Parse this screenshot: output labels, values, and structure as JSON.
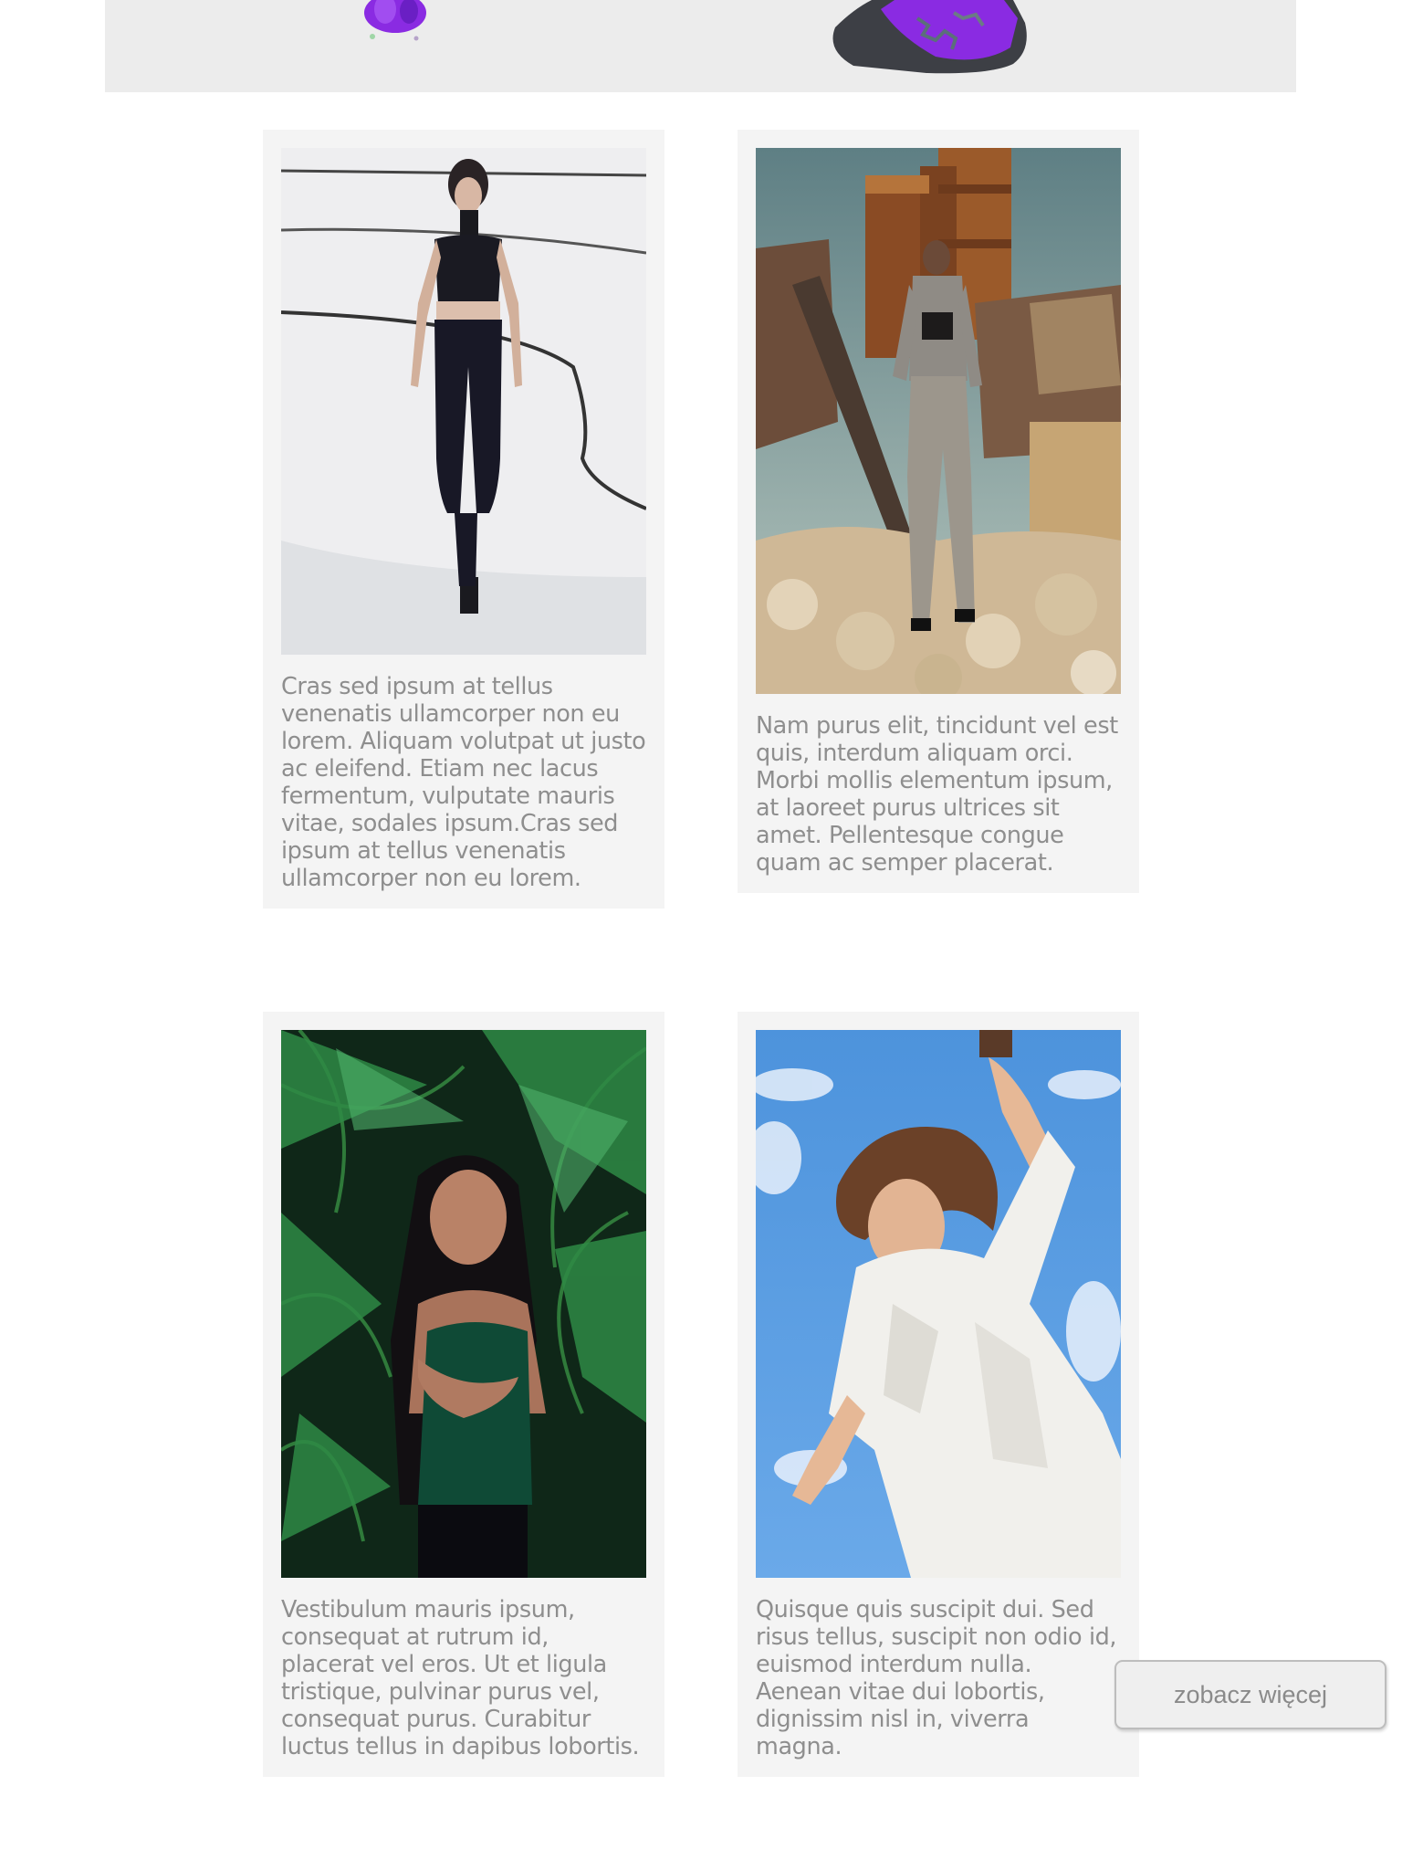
{
  "banner": {
    "accent": "#8a2be2"
  },
  "cards": [
    {
      "image": "runway-model-black-outfit",
      "text": "Cras sed ipsum at tellus venenatis ullamcorper non eu lorem. Aliquam volutpat ut justo ac eleifend. Etiam nec lacus fermentum, vulputate mauris vitae, sodales ipsum.Cras sed ipsum at tellus venenatis ullamcorper non eu lorem."
    },
    {
      "image": "model-grey-suit-industrial-ruins",
      "text": "Nam purus elit, tincidunt vel est quis, interdum aliquam orci. Morbi mollis elementum ipsum, at laoreet purus ultrices sit amet. Pellentesque congue quam ac semper placerat."
    },
    {
      "image": "model-green-top-palm-leaves",
      "text": "Vestibulum mauris ipsum, consequat at rutrum id, placerat vel eros. Ut et ligula tristique, pulvinar purus vel, consequat purus. Curabitur luctus tellus in dapibus lobortis."
    },
    {
      "image": "model-white-suit-blue-sky",
      "text": "Quisque quis suscipit dui. Sed risus tellus, suscipit non odio id, euismod interdum nulla. Aenean vitae dui lobortis, dignissim nisl in, viverra magna."
    }
  ],
  "see_more": {
    "label": "zobacz więcej"
  },
  "colors": {
    "card_bg": "#f4f4f4",
    "text": "#8e8e8e",
    "banner_bg": "#ececec"
  }
}
